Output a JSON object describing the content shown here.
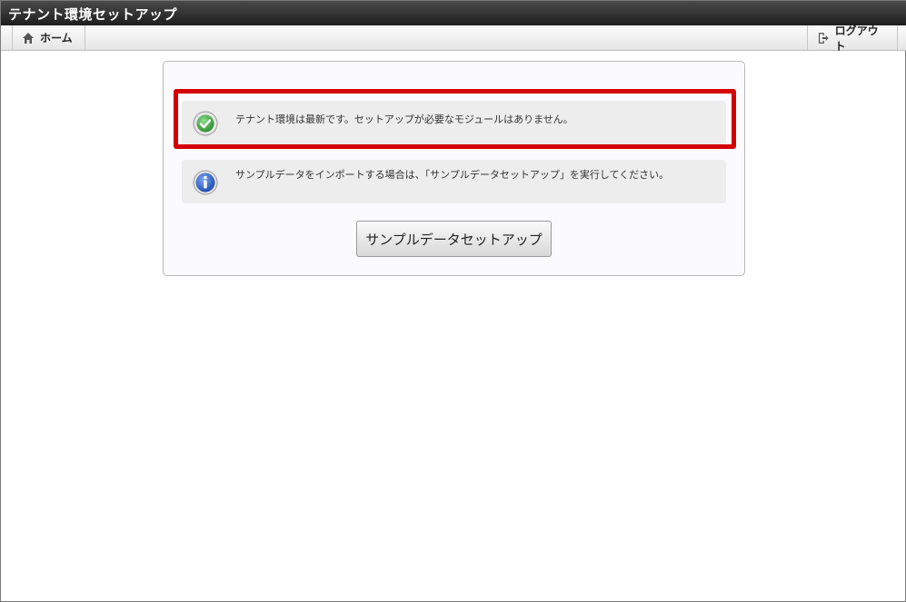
{
  "window": {
    "title": "テナント環境セットアップ"
  },
  "toolbar": {
    "home_label": "ホーム",
    "home_icon": "home-icon",
    "logout_label": "ログアウト",
    "logout_icon": "logout-icon"
  },
  "messages": {
    "success": {
      "text": "テナント環境は最新です。セットアップが必要なモジュールはありません。",
      "icon": "check-circle-icon",
      "color": "#3aa13a"
    },
    "info": {
      "text": "サンプルデータをインポートする場合は、「サンプルデータセットアップ」を実行してください。",
      "icon": "info-circle-icon",
      "color": "#2c5fbf"
    }
  },
  "actions": {
    "sample_setup_label": "サンプルデータセットアップ"
  },
  "colors": {
    "highlight": "#d40000",
    "titlebar": "#2a2a2a"
  }
}
